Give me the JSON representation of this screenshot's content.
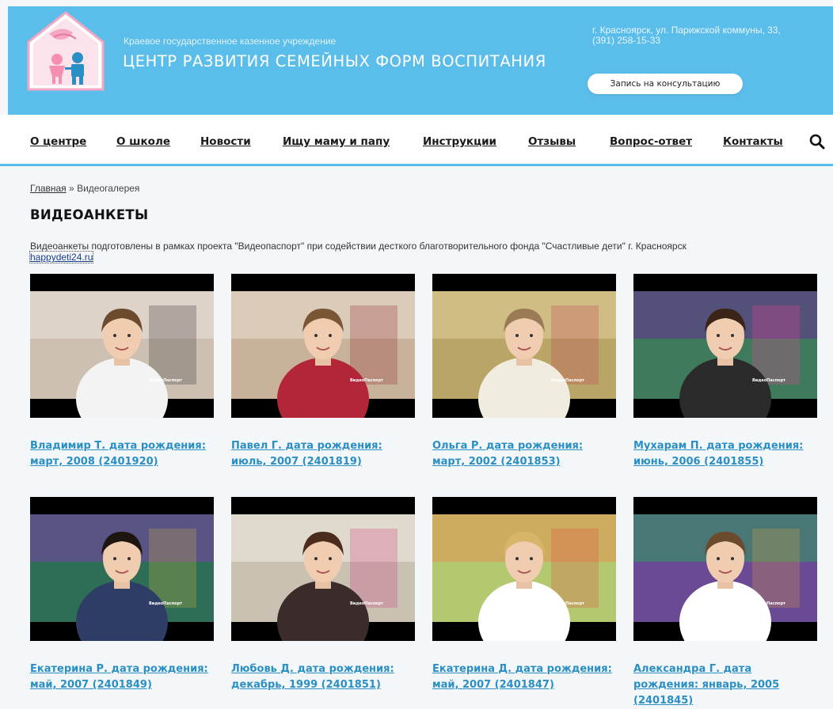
{
  "header": {
    "org_subtitle": "Краевое государственное казенное учреждение",
    "org_title": "ЦЕНТР РАЗВИТИЯ СЕМЕЙНЫХ ФОРМ ВОСПИТАНИЯ",
    "address": "г. Красноярск, ул. Парижской коммуны, 33,",
    "phone": "(391) 258-15-33",
    "consult_button": "Запись на консультацию",
    "logo_icon": "family-house-logo"
  },
  "nav": {
    "items": [
      {
        "label": "О центре"
      },
      {
        "label": "О школе"
      },
      {
        "label": "Новости"
      },
      {
        "label": "Ищу маму и папу"
      },
      {
        "label": "Инструкции"
      },
      {
        "label": "Отзывы"
      },
      {
        "label": "Вопрос-ответ"
      },
      {
        "label": "Контакты"
      }
    ],
    "search_icon": "search-icon"
  },
  "breadcrumb": {
    "home": "Главная",
    "separator": "»",
    "current": "Видеогалерея"
  },
  "page": {
    "title": "ВИДЕОАНКЕТЫ",
    "intro_text": "Видеоанкеты подготовлены в рамках проекта \"Видеопаспорт\" при содействии десткого благотворительного фонда \"Счастливые дети\" г. Красноярск",
    "intro_link": "happydeti24.ru"
  },
  "videos": [
    {
      "title": "Владимир Т. дата рождения: март, 2008 (2401920)",
      "watermark": "ВидеоПаспорт"
    },
    {
      "title": "Павел Г. дата рождения: июль, 2007 (2401819)",
      "watermark": "ВидеоПаспорт"
    },
    {
      "title": "Ольга Р. дата рождения: март, 2002 (2401853)",
      "watermark": "ВидеоПаспорт"
    },
    {
      "title": "Мухарам П. дата рождения: июнь, 2006 (2401855)",
      "watermark": "ВидеоПаспорт"
    },
    {
      "title": "Екатерина Р. дата рождения: май, 2007 (2401849)",
      "watermark": "ВидеоПаспорт"
    },
    {
      "title": "Любовь Д. дата рождения: декабрь, 1999 (2401851)",
      "watermark": "ВидеоПаспорт"
    },
    {
      "title": "Екатерина Д. дата рождения: май, 2007 (2401847)",
      "watermark": "ВидеоПаспорт"
    },
    {
      "title": "Александра Г. дата рождения: январь, 2005 (2401845)",
      "watermark": "ВидеоПаспорт"
    }
  ],
  "colors": {
    "header_bg": "#5bbde9",
    "link": "#2a8fc4",
    "page_bg": "#f4f7f9"
  }
}
